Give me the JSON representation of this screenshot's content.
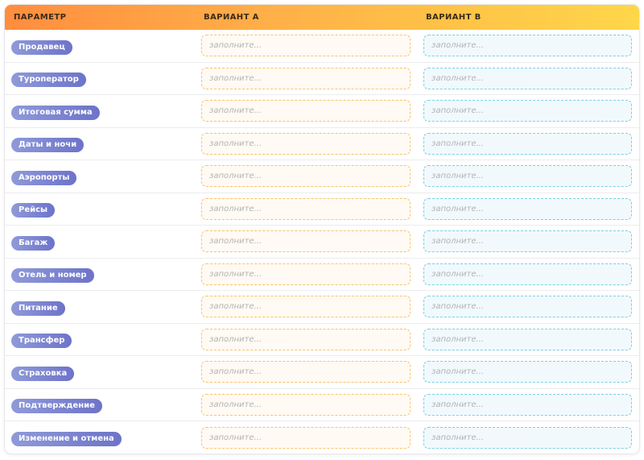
{
  "header": {
    "param": "ПАРАМЕТР",
    "variant_a": "ВАРИАНТ А",
    "variant_b": "ВАРИАНТ В"
  },
  "placeholder": "заполните...",
  "colors": {
    "header_gradient_start": "#ff8d3f",
    "header_gradient_end": "#ffd64a",
    "pill_start": "#8f9ad9",
    "pill_end": "#6d73c9",
    "variant_a_border": "#f7c36f",
    "variant_a_bg": "#fffaf3",
    "variant_b_border": "#79d1e4",
    "variant_b_bg": "#f1f9fd"
  },
  "rows": [
    {
      "label": "Продавец",
      "a": "",
      "b": ""
    },
    {
      "label": "Туроператор",
      "a": "",
      "b": ""
    },
    {
      "label": "Итоговая сумма",
      "a": "",
      "b": ""
    },
    {
      "label": "Даты и ночи",
      "a": "",
      "b": ""
    },
    {
      "label": "Аэропорты",
      "a": "",
      "b": ""
    },
    {
      "label": "Рейсы",
      "a": "",
      "b": ""
    },
    {
      "label": "Багаж",
      "a": "",
      "b": ""
    },
    {
      "label": "Отель и номер",
      "a": "",
      "b": ""
    },
    {
      "label": "Питание",
      "a": "",
      "b": ""
    },
    {
      "label": "Трансфер",
      "a": "",
      "b": ""
    },
    {
      "label": "Страховка",
      "a": "",
      "b": ""
    },
    {
      "label": "Подтверждение",
      "a": "",
      "b": ""
    },
    {
      "label": "Изменение и отмена",
      "a": "",
      "b": ""
    }
  ]
}
